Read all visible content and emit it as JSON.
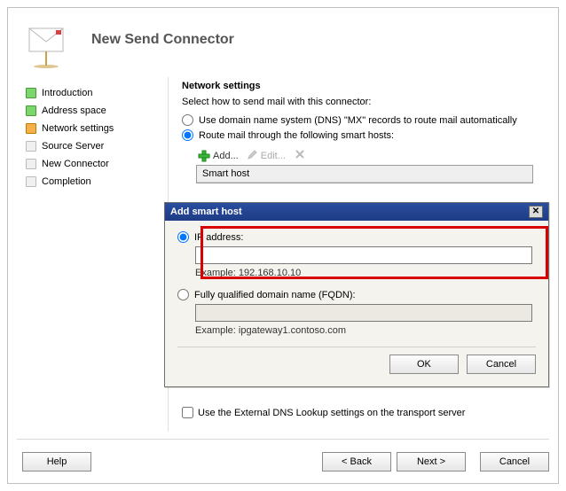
{
  "title": "New Send Connector",
  "nav": [
    {
      "label": "Introduction",
      "state": "done"
    },
    {
      "label": "Address space",
      "state": "done"
    },
    {
      "label": "Network settings",
      "state": "current"
    },
    {
      "label": "Source Server",
      "state": "future"
    },
    {
      "label": "New Connector",
      "state": "future"
    },
    {
      "label": "Completion",
      "state": "future"
    }
  ],
  "section": {
    "title": "Network settings",
    "hint": "Select how to send mail with this connector:",
    "opt_dns": "Use domain name system (DNS) \"MX\" records to route mail automatically",
    "opt_smart": "Route mail through the following smart hosts:"
  },
  "toolbar": {
    "add": "Add...",
    "edit": "Edit...",
    "delete": "Delete"
  },
  "grid": {
    "header": "Smart host"
  },
  "modal": {
    "title": "Add smart host",
    "ip_label": "IP address:",
    "ip_value": "",
    "ip_example": "Example: 192.168.10.10",
    "fqdn_label": "Fully qualified domain name (FQDN):",
    "fqdn_value": "",
    "fqdn_example": "Example: ipgateway1.contoso.com",
    "ok": "OK",
    "cancel": "Cancel"
  },
  "footer_check_label": "Use the External DNS Lookup settings on the transport server",
  "buttons": {
    "help": "Help",
    "back": "< Back",
    "next": "Next >",
    "cancel": "Cancel"
  }
}
